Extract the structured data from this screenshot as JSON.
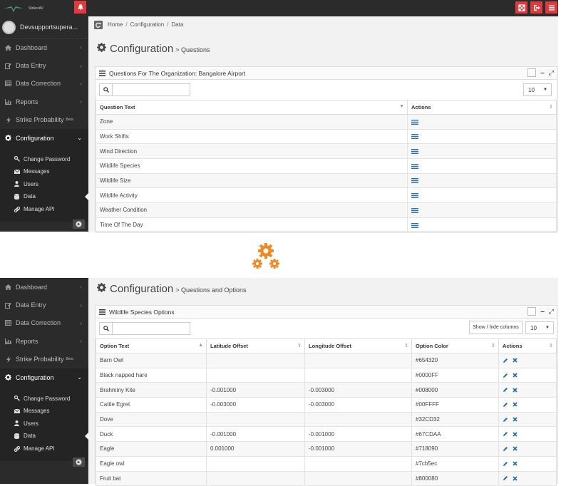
{
  "brand": {
    "name": "StrikerAV"
  },
  "user": {
    "name": "Devsupportsupera..."
  },
  "colors": {
    "accent": "#e03a3e",
    "sidebar": "#2b2b2b",
    "list_icon": "#2a6fb0",
    "gear": "#f08a24"
  },
  "breadcrumb": {
    "home": "Home",
    "sep": "/",
    "config": "Configuration",
    "data": "Data"
  },
  "nav": {
    "dashboard": "Dashboard",
    "data_entry": "Data Entry",
    "data_correction": "Data Correction",
    "reports": "Reports",
    "strike_probability": "Strike Probability",
    "beta": "Beta",
    "configuration": "Configuration"
  },
  "subnav": {
    "change_password": "Change Password",
    "messages": "Messages",
    "users": "Users",
    "data": "Data",
    "manage_api": "Manage API"
  },
  "questions_view": {
    "title": "Configuration",
    "subtitle": "> Questions",
    "panel_title": "Questions For The Organization: Bangalore Airport",
    "page_size": "10",
    "columns": [
      "Question Text",
      "Actions"
    ],
    "rows": [
      "Zone",
      "Work Shifts",
      "Wind Direction",
      "Wildlife Species",
      "Wildlife Size",
      "Wildlife Activity",
      "Weather Condition",
      "Time Of The Day"
    ]
  },
  "options_view": {
    "title": "Configuration",
    "subtitle": "> Questions and Options",
    "panel_title": "Wildlife Species Options",
    "show_hide": "Show / hide columns",
    "page_size": "10",
    "columns": [
      "Option Text",
      "Latitude Offset",
      "Longitude Offset",
      "Option Color",
      "Actions"
    ],
    "rows": [
      [
        "Barn Owl",
        "",
        "",
        "#654320"
      ],
      [
        "Black napped hare",
        "",
        "",
        "#0000FF"
      ],
      [
        "Brahminy Kite",
        "-0.001000",
        "-0.003000",
        "#008000"
      ],
      [
        "Cattle Egret",
        "-0.003000",
        "-0.003000",
        "#00FFFF"
      ],
      [
        "Dove",
        "",
        "",
        "#32CD32"
      ],
      [
        "Duck",
        "-0.001000",
        "-0.001000",
        "#67CDAA"
      ],
      [
        "Eagle",
        "0.001000",
        "-0.001000",
        "#718090"
      ],
      [
        "Eagle owl",
        "",
        "",
        "#7cb5ec"
      ],
      [
        "Fruit bat",
        "",
        "",
        "#800080"
      ]
    ]
  }
}
